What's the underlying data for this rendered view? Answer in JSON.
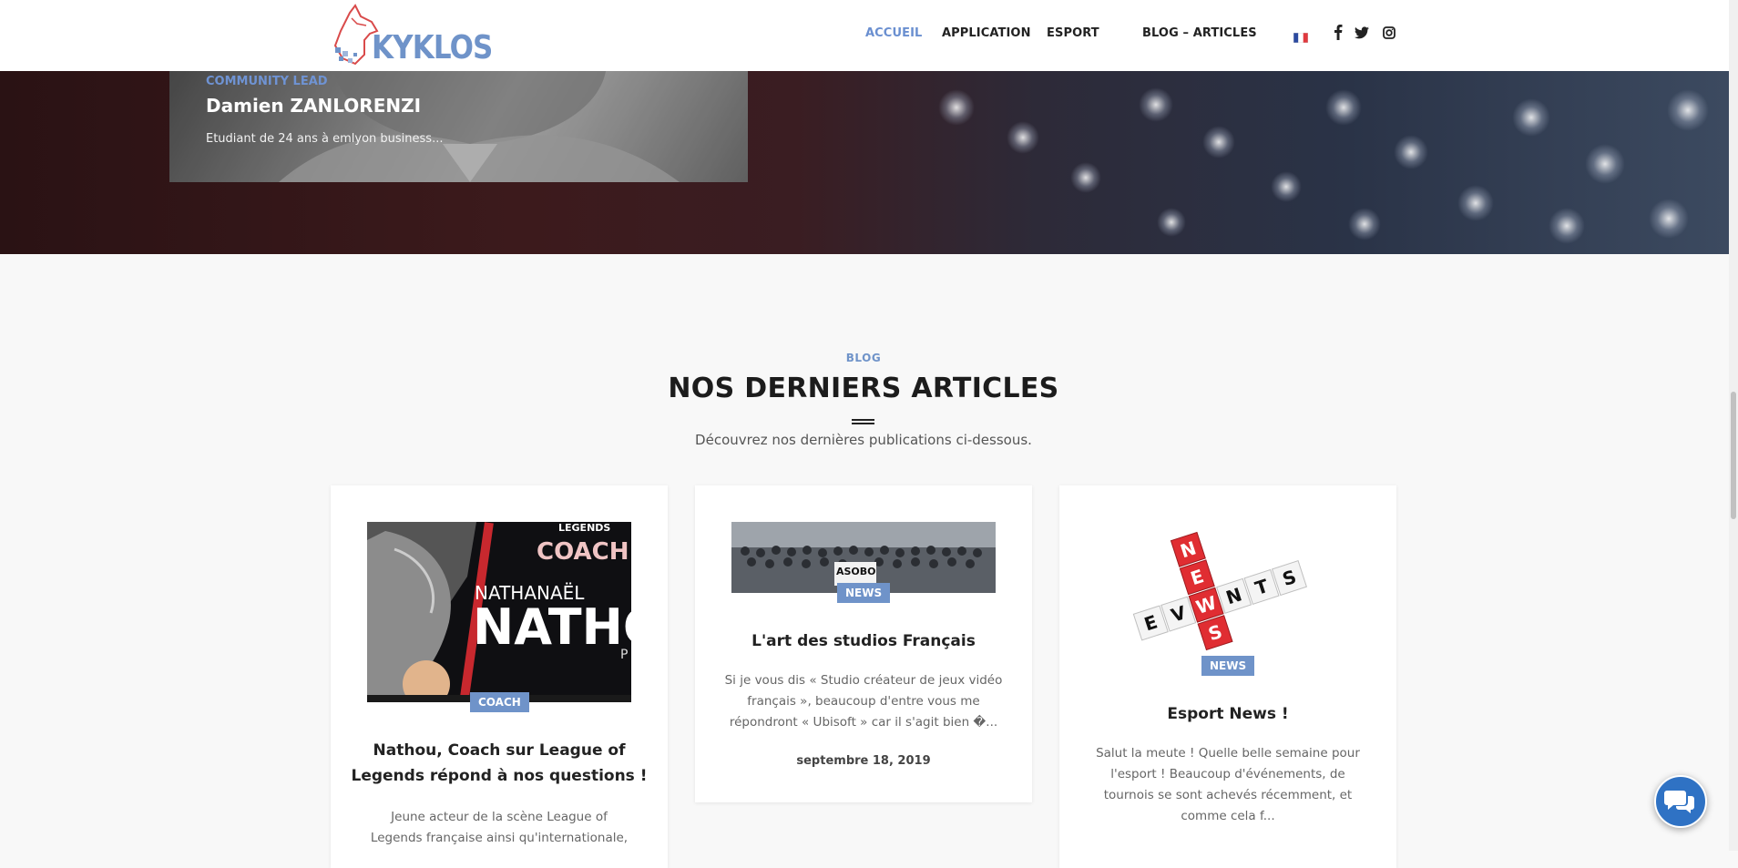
{
  "header": {
    "logo_text": "KYKLOS",
    "nav": [
      {
        "label": "ACCUEIL",
        "active": true
      },
      {
        "label": "APPLICATION",
        "active": false
      },
      {
        "label": "ESPORT",
        "active": false
      },
      {
        "label": "BLOG – ARTICLES",
        "active": false
      }
    ],
    "language_flag": "flag-fr-icon",
    "social_icons": [
      "facebook-icon",
      "twitter-icon",
      "instagram-icon"
    ]
  },
  "hero": {
    "team_member": {
      "role": "COMMUNITY LEAD",
      "name": "Damien ZANLORENZI",
      "description": "Etudiant de 24 ans à emlyon business..."
    }
  },
  "blog": {
    "eyebrow": "BLOG",
    "title": "NOS DERNIERS ARTICLES",
    "subtitle": "Découvrez nos dernières publications ci-dessous.",
    "posts": [
      {
        "image_texts": {
          "top": "LEGENDS",
          "coach": "COACH",
          "first_name": "NATHANAËL",
          "nick": "NATHO",
          "small": "P"
        },
        "tag": "COACH",
        "title_line1": "Nathou, Coach sur League of",
        "title_line2": "Legends répond à nos questions !",
        "excerpt_line1": "Jeune acteur de la scène League of",
        "excerpt_line2": "Legends française ainsi qu'internationale,"
      },
      {
        "image_texts": {
          "sign": "ASOBO"
        },
        "tag": "NEWS",
        "title": "L'art des studios Français",
        "excerpt_line1": "Si je vous dis « Studio créateur de jeux vidéo",
        "excerpt_line2": "français », beaucoup d'entre vous me",
        "excerpt_line3": "répondront « Ubisoft » car il s'agit bien �...",
        "date": "septembre 18, 2019"
      },
      {
        "image_texts": {
          "across": "EVENTS",
          "down": "NEWS"
        },
        "tag": "NEWS",
        "title": "Esport News !",
        "excerpt_line1": "Salut la meute ! Quelle belle semaine pour",
        "excerpt_line2": "l'esport ! Beaucoup d'événements, de",
        "excerpt_line3": "tournois se sont achevés récemment, et",
        "excerpt_line4": "comme cela f..."
      }
    ]
  },
  "colors": {
    "accent": "#6f93c9",
    "tag_bg": "#6f93c9",
    "chat_button": "#2f72c4"
  }
}
